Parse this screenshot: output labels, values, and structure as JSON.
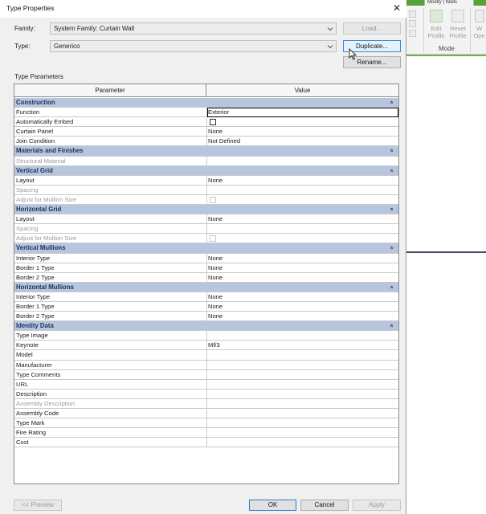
{
  "dialog": {
    "title": "Type Properties",
    "family_label": "Family:",
    "family_value": "System Family: Curtain Wall",
    "type_label": "Type:",
    "type_value": "Generico",
    "load_label": "Load...",
    "duplicate_label": "Duplicate...",
    "rename_label": "Rename...",
    "type_parameters_label": "Type Parameters",
    "col_parameter": "Parameter",
    "col_value": "Value"
  },
  "groups": [
    {
      "title": "Construction",
      "rows": [
        {
          "param": "Function",
          "value": "Exterior"
        },
        {
          "param": "Automatically Embed",
          "value": ""
        },
        {
          "param": "Curtain Panel",
          "value": "None"
        },
        {
          "param": "Join Condition",
          "value": "Not Defined"
        }
      ]
    },
    {
      "title": "Materials and Finishes",
      "rows": [
        {
          "param": "Structural Material",
          "value": ""
        }
      ]
    },
    {
      "title": "Vertical Grid",
      "rows": [
        {
          "param": "Layout",
          "value": "None"
        },
        {
          "param": "Spacing",
          "value": ""
        },
        {
          "param": "Adjust for Mullion Size",
          "value": ""
        }
      ]
    },
    {
      "title": "Horizontal Grid",
      "rows": [
        {
          "param": "Layout",
          "value": "None"
        },
        {
          "param": "Spacing",
          "value": ""
        },
        {
          "param": "Adjust for Mullion Size",
          "value": ""
        }
      ]
    },
    {
      "title": "Vertical Mullions",
      "rows": [
        {
          "param": "Interior Type",
          "value": "None"
        },
        {
          "param": "Border 1 Type",
          "value": "None"
        },
        {
          "param": "Border 2 Type",
          "value": "None"
        }
      ]
    },
    {
      "title": "Horizontal Mullions",
      "rows": [
        {
          "param": "Interior Type",
          "value": "None"
        },
        {
          "param": "Border 1 Type",
          "value": "None"
        },
        {
          "param": "Border 2 Type",
          "value": "None"
        }
      ]
    },
    {
      "title": "Identity Data",
      "rows": [
        {
          "param": "Type Image",
          "value": ""
        },
        {
          "param": "Keynote",
          "value": "Mf/3"
        },
        {
          "param": "Model",
          "value": ""
        },
        {
          "param": "Manufacturer",
          "value": ""
        },
        {
          "param": "Type Comments",
          "value": ""
        },
        {
          "param": "URL",
          "value": ""
        },
        {
          "param": "Description",
          "value": ""
        },
        {
          "param": "Assembly Description",
          "value": ""
        },
        {
          "param": "Assembly Code",
          "value": ""
        },
        {
          "param": "Type Mark",
          "value": ""
        },
        {
          "param": "Fire Rating",
          "value": ""
        },
        {
          "param": "Cost",
          "value": ""
        }
      ]
    }
  ],
  "footer": {
    "preview_label": "<< Preview",
    "ok_label": "OK",
    "cancel_label": "Cancel",
    "apply_label": "Apply"
  },
  "ribbon": {
    "tab_label": "Modify | Walls",
    "edit_profile": "Edit\nProfile",
    "reset_profile": "Reset\nProfile",
    "ope": "W\nOpe",
    "panel_label": "Mode"
  }
}
